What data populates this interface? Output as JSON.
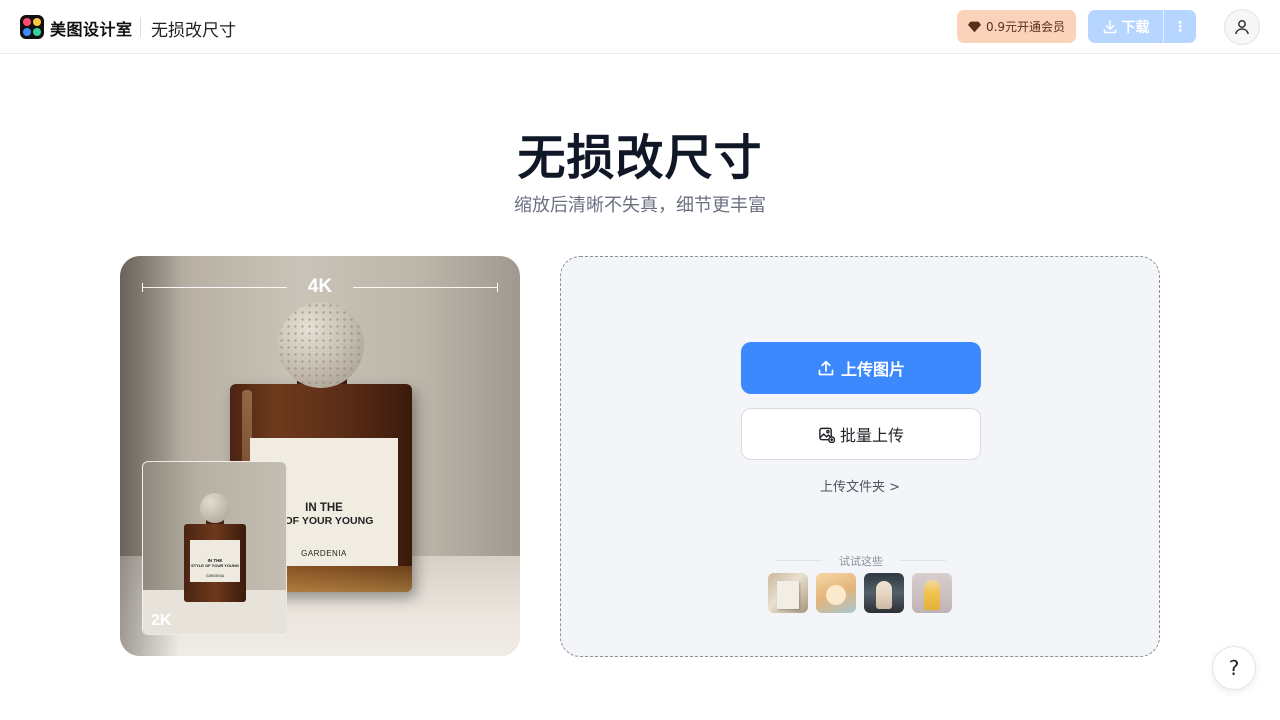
{
  "header": {
    "brand": "美图设计室",
    "page_name": "无损改尺寸",
    "vip_label": "0.9元开通会员",
    "download_label": "下载",
    "more_label": "⋮"
  },
  "hero": {
    "title": "无损改尺寸",
    "subtitle": "缩放后清晰不失真，细节更丰富"
  },
  "preview": {
    "label_4k": "4K",
    "label_2k": "2K",
    "bottle_line1": "IN THE",
    "bottle_line2": "E  OF YOUR YOUNG",
    "bottle_line3": "GARDENIA",
    "mini_line1": "IN THE",
    "mini_line2": "STYLE  OF YOUR YOUNG",
    "mini_line3": "GARDENIA"
  },
  "upload": {
    "upload_button": "上传图片",
    "batch_button": "批量上传",
    "folder_link": "上传文件夹 >",
    "try_label": "试试这些"
  },
  "help": {
    "label": "?"
  },
  "colors": {
    "primary": "#3b89fd",
    "vip_bg": "#fbd3bb",
    "download_disabled": "#b6d6ff"
  }
}
